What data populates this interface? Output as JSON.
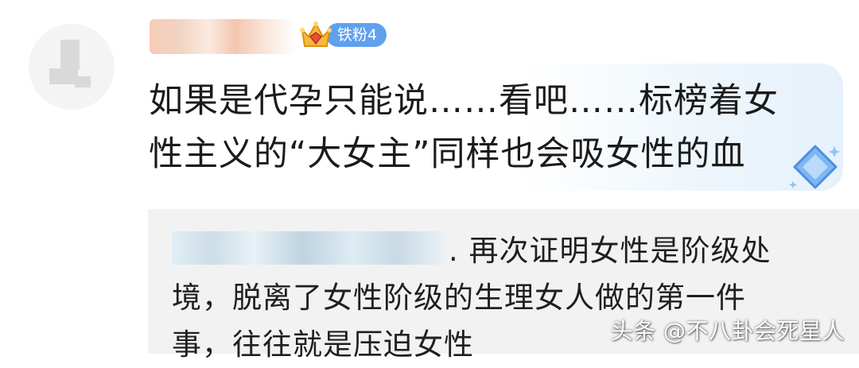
{
  "comment": {
    "fan_badge_label": "铁粉4",
    "text": "如果是代孕只能说……看吧……标榜着女性主义的“大女主”同样也会吸女性的血"
  },
  "reply": {
    "text": ". 再次证明女性是阶级处境，脱离了女性阶级的生理女人做的第一件事，往往就是压迫女性"
  },
  "watermark": {
    "text": "头条 @不八卦会死星人"
  },
  "icons": {
    "crown": "crown-icon",
    "diamond": "diamond-icon"
  },
  "colors": {
    "badge_blue": "#5fa1ef",
    "bubble_tint": "#e6f1fb",
    "reply_background": "#f2f2f2"
  }
}
